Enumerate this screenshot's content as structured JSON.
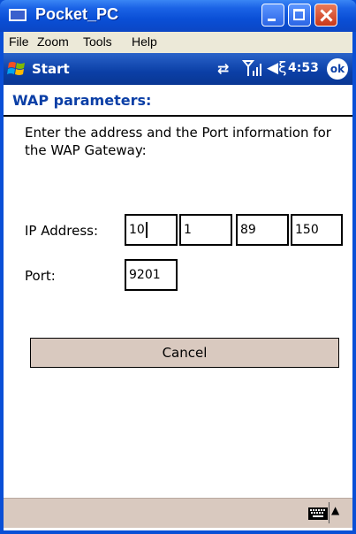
{
  "window": {
    "title": "Pocket_PC"
  },
  "menubar": {
    "items": [
      {
        "label": "File"
      },
      {
        "label": "Zoom"
      },
      {
        "label": "Tools"
      },
      {
        "label": "Help"
      }
    ]
  },
  "navbar": {
    "start_label": "Start",
    "time": "4:53",
    "ok_label": "ok",
    "icons": [
      "windows-flag-icon",
      "sync-icon",
      "signal-icon",
      "speaker-icon"
    ]
  },
  "page": {
    "title": "WAP parameters:",
    "instructions": "Enter the address and the Port information for the WAP Gateway:",
    "ip_label": "IP Address:",
    "ip_octets": [
      "10",
      "1",
      "89",
      "150"
    ],
    "port_label": "Port:",
    "port_value": "9201",
    "cancel_label": "Cancel"
  },
  "bottombar": {
    "icons": [
      "keyboard-icon",
      "sip-arrow-icon"
    ]
  },
  "colors": {
    "title_blue": "#0b3fa6",
    "button_bg": "#d9c9bf",
    "xp_blue": "#0a4fd6"
  }
}
